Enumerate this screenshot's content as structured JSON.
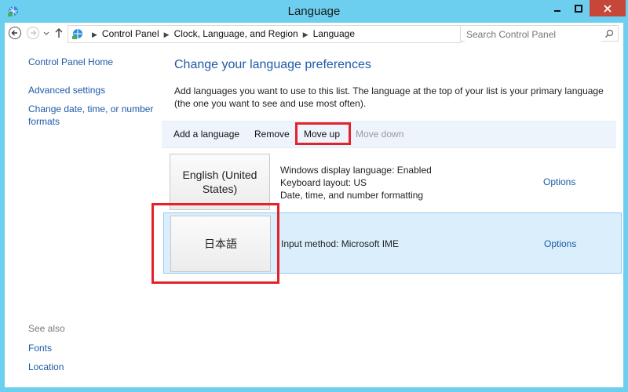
{
  "window": {
    "title": "Language",
    "controls": {
      "minimize": "minimize",
      "maximize": "maximize",
      "close": "close"
    }
  },
  "address": {
    "breadcrumbs": [
      "Control Panel",
      "Clock, Language, and Region",
      "Language"
    ],
    "search_placeholder": "Search Control Panel"
  },
  "sidebar": {
    "links": [
      "Control Panel Home",
      "Advanced settings",
      "Change date, time, or number formats"
    ],
    "see_also_label": "See also",
    "see_also_links": [
      "Fonts",
      "Location"
    ]
  },
  "main": {
    "heading": "Change your language preferences",
    "description": "Add languages you want to use to this list. The language at the top of your list is your primary language (the one you want to see and use most often).",
    "toolbar": {
      "add": "Add a language",
      "remove": "Remove",
      "move_up": "Move up",
      "move_down": "Move down"
    },
    "languages": [
      {
        "name": "English (United States)",
        "details": [
          "Windows display language: Enabled",
          "Keyboard layout: US",
          "Date, time, and number formatting"
        ],
        "options": "Options"
      },
      {
        "name": "日本語",
        "details": [
          "Input method: Microsoft IME"
        ],
        "options": "Options"
      }
    ]
  },
  "colors": {
    "frame": "#6ccff0",
    "link": "#1e5aa8",
    "highlight": "#e3232b",
    "selected_row": "#dbeefb",
    "close_button": "#c7463a"
  }
}
